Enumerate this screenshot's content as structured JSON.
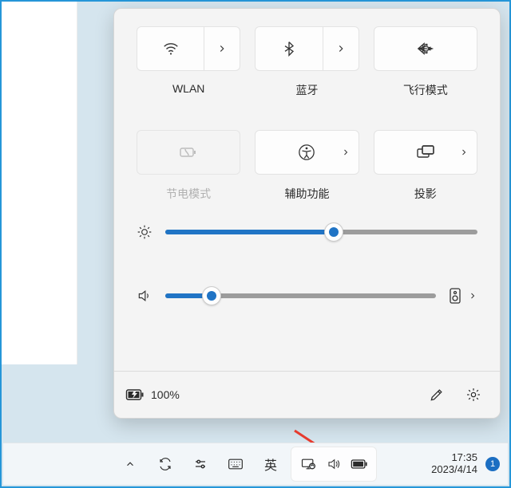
{
  "tiles": {
    "row1": [
      {
        "label": "WLAN",
        "split": true,
        "icon": "wifi"
      },
      {
        "label": "蓝牙",
        "split": true,
        "icon": "bluetooth"
      },
      {
        "label": "飞行模式",
        "split": false,
        "icon": "airplane"
      }
    ],
    "row2": [
      {
        "label": "节电模式",
        "split": false,
        "icon": "battery-saver",
        "disabled": true
      },
      {
        "label": "辅助功能",
        "split": false,
        "icon": "accessibility",
        "chevron": true
      },
      {
        "label": "投影",
        "split": false,
        "icon": "project",
        "chevron": true
      }
    ]
  },
  "sliders": {
    "brightness": {
      "value": 54
    },
    "volume": {
      "value": 17
    }
  },
  "footer": {
    "battery_text": "100%"
  },
  "taskbar": {
    "ime_text": "英",
    "time": "17:35",
    "date": "2023/4/14",
    "notif_count": "1"
  }
}
